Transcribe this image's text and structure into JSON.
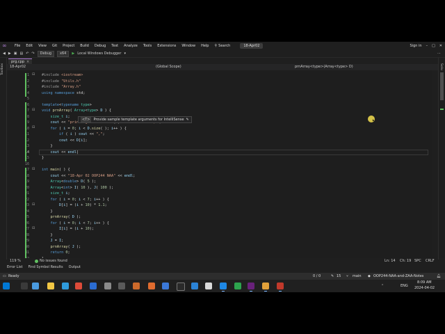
{
  "menu": {
    "items": [
      "File",
      "Edit",
      "View",
      "Git",
      "Project",
      "Build",
      "Debug",
      "Test",
      "Analyze",
      "Tools",
      "Extensions",
      "Window",
      "Help"
    ],
    "search": "Search",
    "solution": "18-Apr02",
    "sign_in": "Sign in"
  },
  "toolbar": {
    "config": "Debug",
    "platform": "x64",
    "run": "Local Windows Debugger"
  },
  "side_left": "Toolbox",
  "side_right": "Solution Explorer",
  "tab": {
    "label": "prg.cpp",
    "close": "×"
  },
  "navbar": {
    "project": "18-Apr02",
    "scope": "(Global Scope)",
    "member": "prnArray<type>(Array<type> D)"
  },
  "hint": {
    "badge": "<T>",
    "text": "Provide sample template arguments for IntelliSense",
    "edit": "✎"
  },
  "code": {
    "line_numbers": [
      "1",
      "2",
      "3",
      "4",
      "5",
      "6",
      "7",
      "8",
      "9",
      "10",
      "11",
      "12",
      "13",
      "14",
      "15",
      "16",
      "17",
      "18",
      "19",
      "20",
      "21",
      "22",
      "23",
      "24",
      "25",
      "26",
      "27",
      "28",
      "29",
      "30",
      "31",
      "32"
    ],
    "current_line": "14"
  },
  "status": {
    "zoom": "119 %",
    "issues": "No issues found",
    "position": "Ln: 14",
    "col": "Ch: 19",
    "spc": "SPC",
    "crlf": "CRLF"
  },
  "tool_windows": [
    "Error List",
    "Find Symbol Results",
    "Output"
  ],
  "statusbar": {
    "ready": "Ready",
    "errors": "0 / 0",
    "changes": "15",
    "branch": "main",
    "repo": "OOP244-NAA-and-ZAA-Notes"
  },
  "taskbar": {
    "lang": "ENG",
    "time": "8:09 AM",
    "date": "2024-04-02"
  },
  "colors": {
    "accent": "#b180d7",
    "status_ok": "#61c161"
  }
}
